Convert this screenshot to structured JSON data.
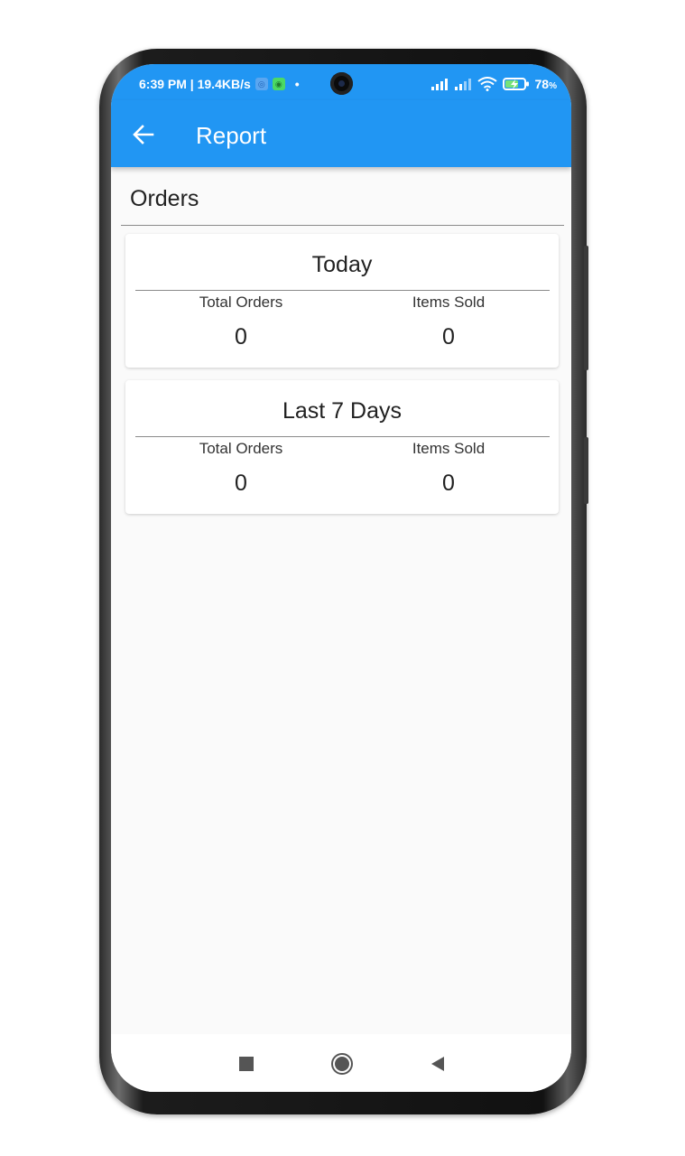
{
  "status_bar": {
    "time_speed": "6:39 PM | 19.4KB/s",
    "dot": "•",
    "battery_percent": "78",
    "battery_unit": "%"
  },
  "app_bar": {
    "title": "Report"
  },
  "section": {
    "title": "Orders"
  },
  "cards": [
    {
      "title": "Today",
      "stats": [
        {
          "label": "Total Orders",
          "value": "0"
        },
        {
          "label": "Items Sold",
          "value": "0"
        }
      ]
    },
    {
      "title": "Last 7 Days",
      "stats": [
        {
          "label": "Total Orders",
          "value": "0"
        },
        {
          "label": "Items Sold",
          "value": "0"
        }
      ]
    }
  ],
  "colors": {
    "primary": "#2196f3",
    "background": "#fafafa",
    "card": "#ffffff",
    "text": "#212121"
  },
  "icons": {
    "back": "arrow-back-icon",
    "nav_recents": "square-icon",
    "nav_home": "circle-icon",
    "nav_back": "triangle-back-icon"
  }
}
